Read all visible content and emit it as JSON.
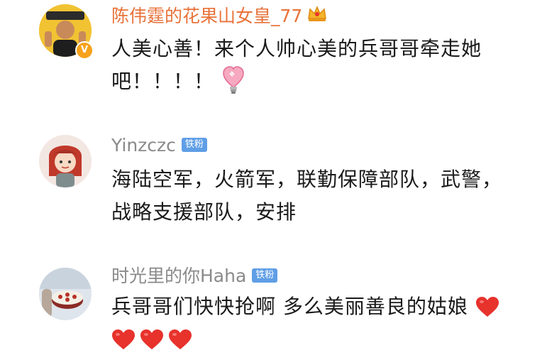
{
  "comments": [
    {
      "username": "陈伟霆的花果山女皇_77",
      "badge": "",
      "line1": "人美心善！来个人帅心美的兵哥哥牵走她",
      "line2": "吧！！！！",
      "icons": [
        "crown-icon",
        "verified-icon",
        "lightbulb-heart-icon"
      ]
    },
    {
      "username": "Yinzczc",
      "badge": "铁粉",
      "line1": "海陆空军，火箭军，联勤保障部队，武警，",
      "line2": "战略支援部队，安排"
    },
    {
      "username": "时光里的你Haha",
      "badge": "铁粉",
      "line1": "兵哥哥们快快抢啊 多么美丽善良的姑娘",
      "icons": [
        "heart-icon",
        "heart-icon",
        "heart-icon",
        "heart-icon"
      ]
    }
  ],
  "colors": {
    "vip_name": "#e8723a",
    "name": "#8a8a8a",
    "badge_bg": "#5f9ee6",
    "text": "#1a1a1a",
    "heart": "#e8322c"
  }
}
